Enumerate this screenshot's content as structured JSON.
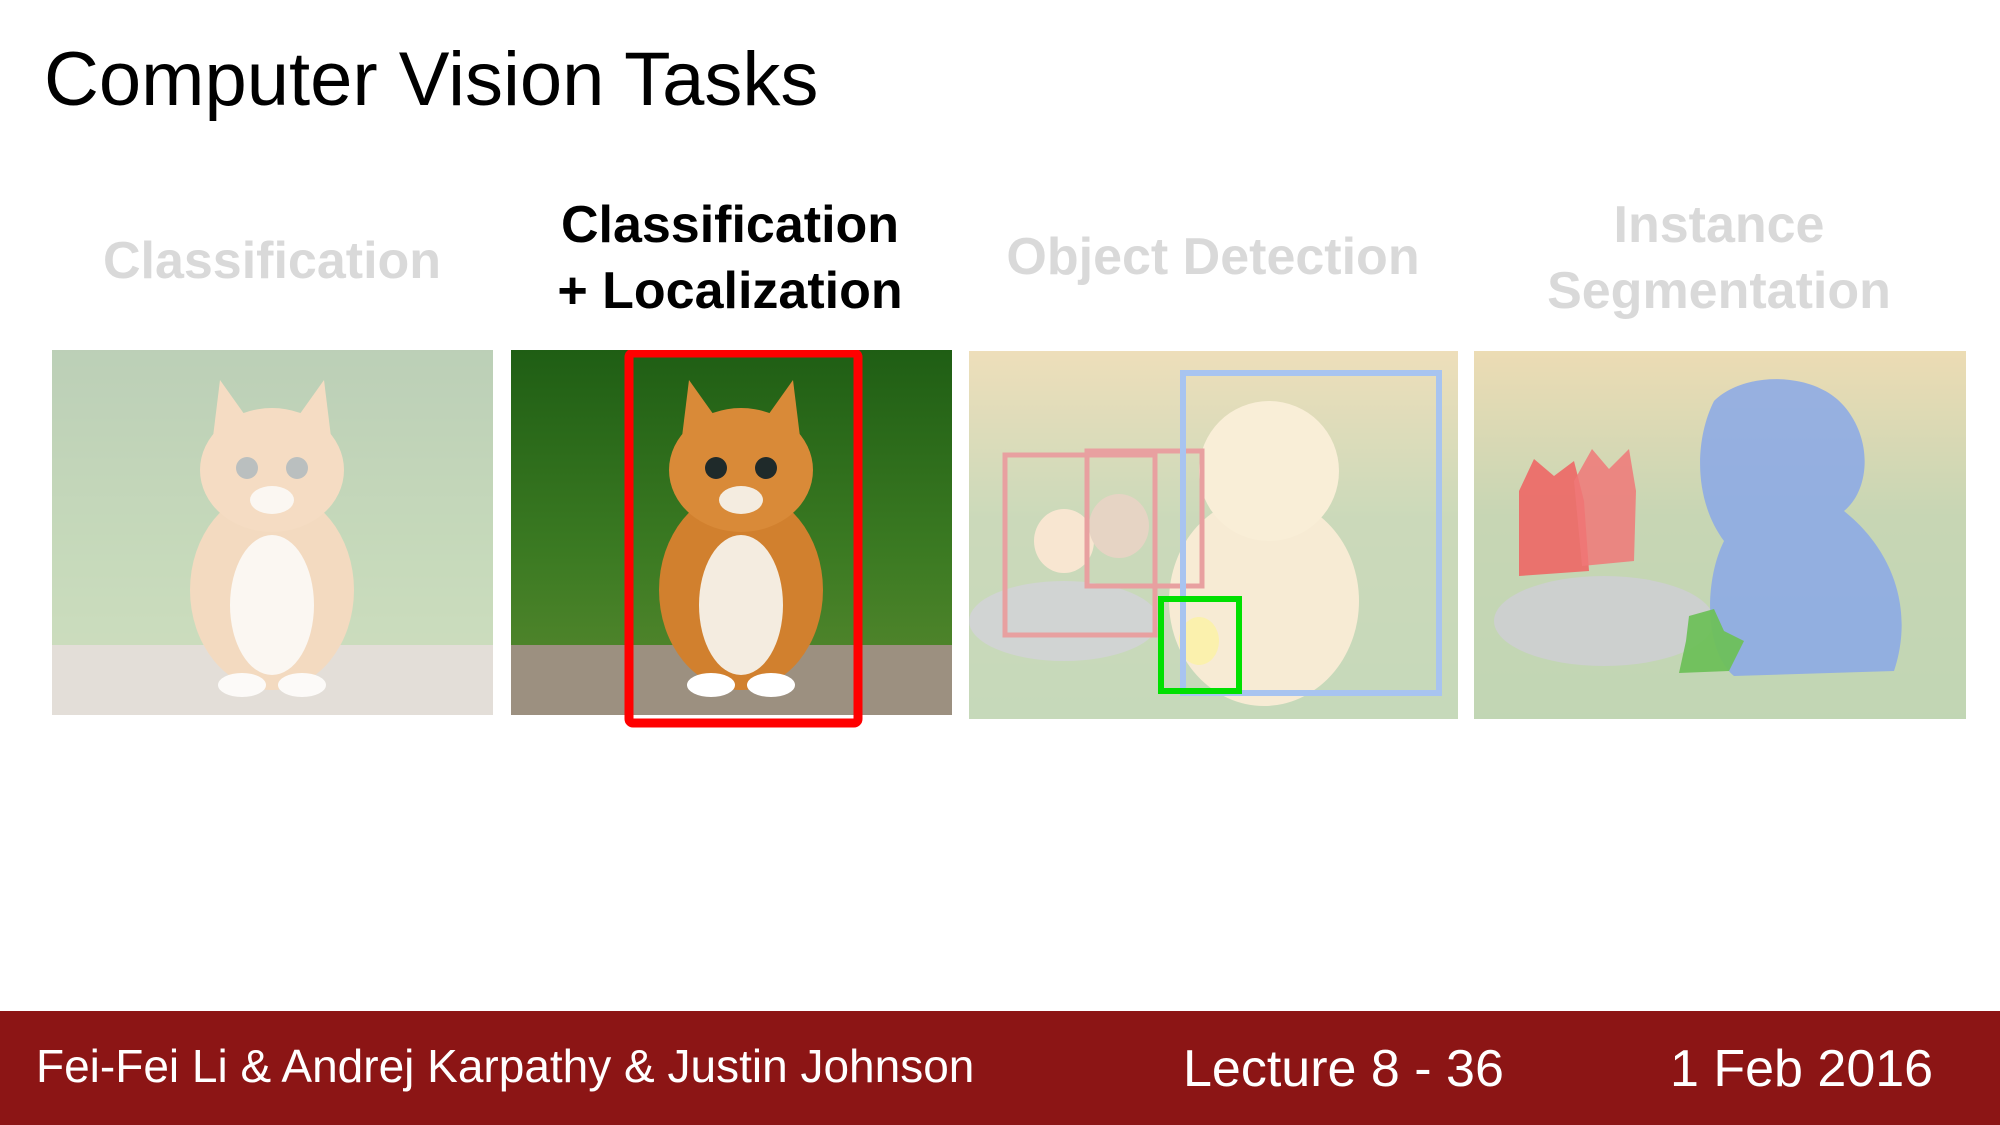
{
  "slide": {
    "title": "Computer Vision Tasks"
  },
  "tasks": [
    {
      "line1": "Classification",
      "line2": "",
      "active": false
    },
    {
      "line1": "Classification",
      "line2": "+ Localization",
      "active": true
    },
    {
      "line1": "Object Detection",
      "line2": "",
      "active": false
    },
    {
      "line1": "Instance",
      "line2": "Segmentation",
      "active": false
    }
  ],
  "images": {
    "classification": "kitten-photo",
    "localization": "kitten-photo-with-red-bounding-box",
    "detection": "cats-dog-duck-photo-with-colored-boxes",
    "segmentation": "cats-dog-duck-photo-with-colored-masks"
  },
  "colors": {
    "active_box": "#ff0000",
    "cat_box": "#e8a0a0",
    "dog_box": "#a8c4f0",
    "duck_box": "#00e000",
    "footer_bg": "#8c1515",
    "faded_text": "#d9d9d9"
  },
  "footer": {
    "authors": "Fei-Fei Li & Andrej Karpathy & Justin Johnson",
    "lecture": "Lecture 8 - 36",
    "date": "1 Feb 2016"
  }
}
